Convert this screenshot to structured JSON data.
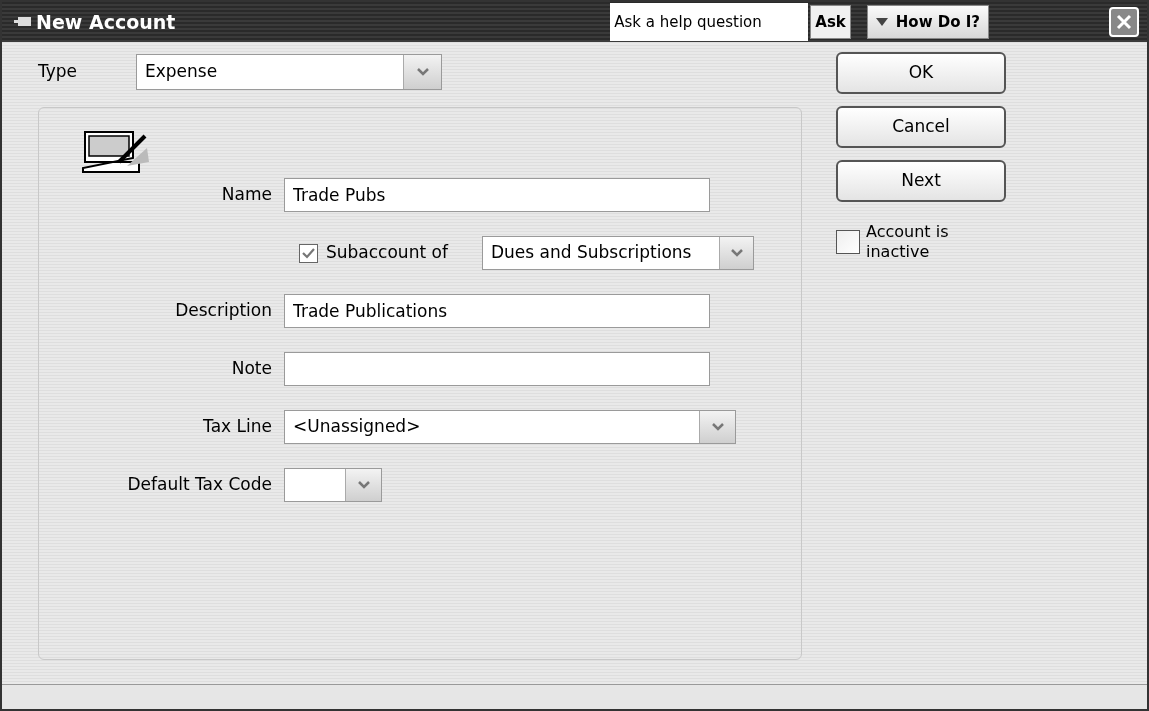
{
  "window": {
    "title": "New Account"
  },
  "help": {
    "placeholder": "Ask a help question",
    "ask_button": "Ask",
    "how_do_i": "How Do I?"
  },
  "type": {
    "label": "Type",
    "value": "Expense"
  },
  "fields": [
    {
      "kind": "text",
      "label": "Name",
      "value": "Trade Pubs"
    },
    {
      "kind": "subaccount",
      "label": "Subaccount of",
      "checked": true,
      "value": "Dues and Subscriptions"
    },
    {
      "kind": "text",
      "label": "Description",
      "value": "Trade Publications"
    },
    {
      "kind": "text",
      "label": "Note"
    },
    {
      "kind": "select",
      "label": "Tax Line",
      "value": "<Unassigned>"
    },
    {
      "kind": "small_select",
      "label": "Default Tax Code"
    }
  ],
  "buttons": [
    "OK",
    "Cancel",
    "Next"
  ],
  "inactive": {
    "label": "Account is inactive",
    "checked": false
  }
}
